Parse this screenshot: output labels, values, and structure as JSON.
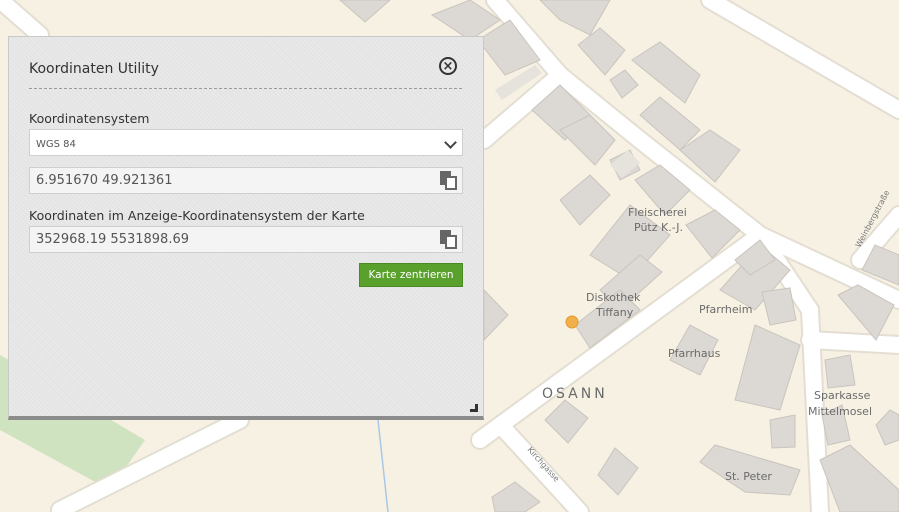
{
  "map": {
    "labels": {
      "fleischerei_line1": "Fleischerei",
      "fleischerei_line2": "Pütz K.-J.",
      "disko_line1": "Diskothek",
      "disko_line2": "Tiffany",
      "pfarrheim": "Pfarrheim",
      "pfarrhaus": "Pfarrhaus",
      "osann": "OSANN",
      "sparkasse_line1": "Sparkasse",
      "sparkasse_line2": "Mittelmosel",
      "stpeter": "St. Peter",
      "weinbergstrasse": "Weinbergstraße",
      "kirchgasse": "Kirchgasse"
    },
    "colors": {
      "background": "#f6f1e3",
      "building": "#dcd8d3",
      "road": "#ffffff",
      "marker": "#f2b04a"
    }
  },
  "panel": {
    "title": "Koordinaten Utility",
    "close_icon": "close-circle-icon",
    "coord_system_label": "Koordinatensystem",
    "coord_system_selected": "WGS 84",
    "coords_value": "6.951670 49.921361",
    "display_coords_label": "Koordinaten im Anzeige-Koordinatensystem der Karte",
    "display_coords_value": "352968.19 5531898.69",
    "center_button_label": "Karte zentrieren",
    "colors": {
      "button": "#5aa02c"
    }
  }
}
